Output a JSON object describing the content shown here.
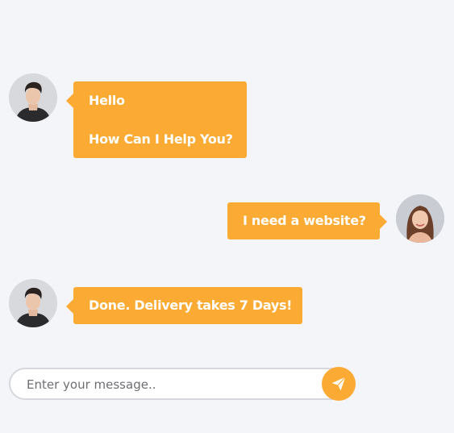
{
  "colors": {
    "background": "#f4f5f9",
    "accent": "#fbab33",
    "bubble_text": "#ffffff",
    "input_border": "#d6d8de"
  },
  "messages": [
    {
      "sender": "agent",
      "avatar_icon": "male-avatar-icon",
      "lines": [
        "Hello",
        "How Can I Help You?"
      ]
    },
    {
      "sender": "user",
      "avatar_icon": "female-avatar-icon",
      "lines": [
        "I need a website?"
      ]
    },
    {
      "sender": "agent",
      "avatar_icon": "male-avatar-icon",
      "lines": [
        "Done. Delivery takes 7 Days!"
      ]
    }
  ],
  "composer": {
    "placeholder": "Enter your message..",
    "send_icon": "paper-plane-icon"
  }
}
